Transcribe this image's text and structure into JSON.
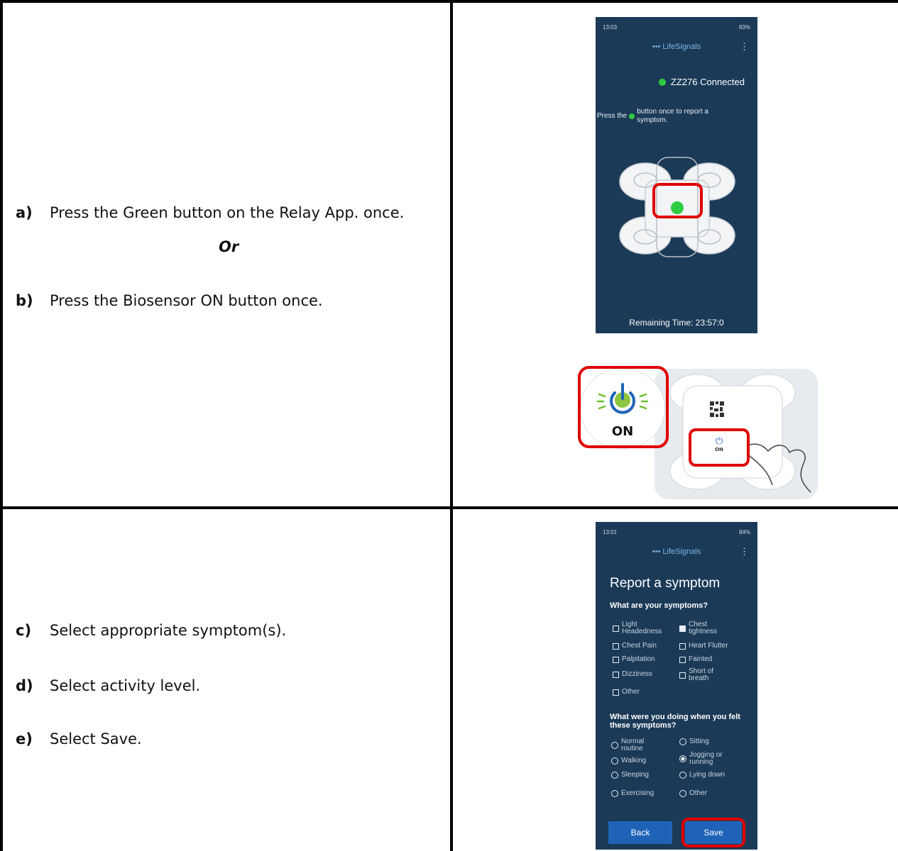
{
  "row1": {
    "step_a_label": "a)",
    "step_a_text": "Press the Green button on the Relay App. once.",
    "or_text": "Or",
    "step_b_label": "b)",
    "step_b_text": "Press the Biosensor ON button once."
  },
  "row2": {
    "step_c_label": "c)",
    "step_c_text": "Select appropriate symptom(s).",
    "step_d_label": "d)",
    "step_d_text": "Select activity level.",
    "step_e_label": "e)",
    "step_e_text": "Select Save."
  },
  "phone1": {
    "time": "13:03",
    "battery": "83%",
    "brand": "LifeSignals",
    "connected": "ZZ276 Connected",
    "instruction_prefix": "Press the",
    "instruction_suffix": "button once to report a symptom.",
    "remaining": "Remaining Time: 23:57:0"
  },
  "device": {
    "on_label": "ON",
    "small_on_label": "ON"
  },
  "phone2": {
    "time": "13:01",
    "battery": "84%",
    "brand": "LifeSignals",
    "title": "Report a symptom",
    "symptoms_question": "What are your symptoms?",
    "symptoms": [
      {
        "label": "Light Headedness",
        "checked": false
      },
      {
        "label": "Chest tightness",
        "checked": true
      },
      {
        "label": "Chest Pain",
        "checked": false
      },
      {
        "label": "Heart Flutter",
        "checked": false
      },
      {
        "label": "Palpitation",
        "checked": false
      },
      {
        "label": "Fainted",
        "checked": false
      },
      {
        "label": "Dizziness",
        "checked": false
      },
      {
        "label": "Short of breath",
        "checked": false
      },
      {
        "label": "Other",
        "checked": false
      }
    ],
    "activity_question": "What were you doing when you felt these symptoms?",
    "activities": [
      {
        "label": "Normal routine",
        "selected": false
      },
      {
        "label": "Sitting",
        "selected": false
      },
      {
        "label": "Walking",
        "selected": false
      },
      {
        "label": "Jogging or running",
        "selected": true
      },
      {
        "label": "Sleeping",
        "selected": false
      },
      {
        "label": "Lying down",
        "selected": false
      },
      {
        "label": "Exercising",
        "selected": false
      },
      {
        "label": "Other",
        "selected": false
      }
    ],
    "back_label": "Back",
    "save_label": "Save"
  },
  "colors": {
    "phone_bg": "#1b3a57",
    "highlight": "#e00000",
    "accent_green": "#2ecc40",
    "button_blue": "#1f63b8"
  }
}
